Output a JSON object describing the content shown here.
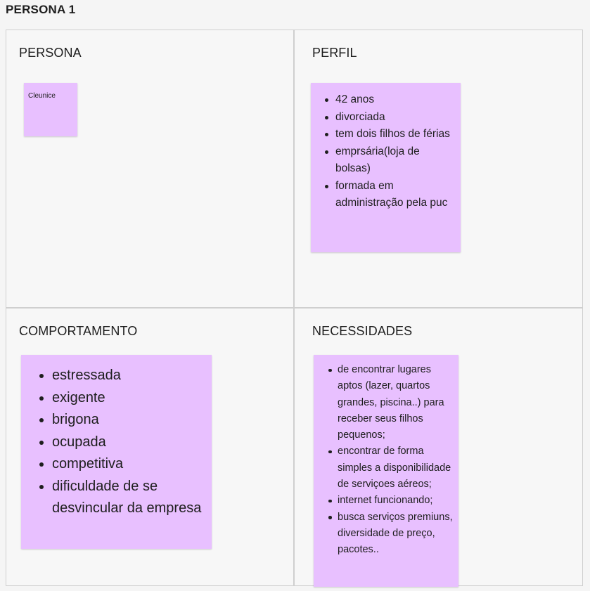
{
  "board": {
    "title": "PERSONA 1"
  },
  "sections": {
    "persona": {
      "title": "PERSONA",
      "note_text": "Cleunice"
    },
    "perfil": {
      "title": "PERFIL",
      "items": [
        "42 anos",
        "divorciada",
        "tem dois filhos de férias",
        "emprsária(loja de bolsas)",
        "formada em administração pela puc"
      ]
    },
    "comportamento": {
      "title": "COMPORTAMENTO",
      "items": [
        "estressada",
        "exigente",
        "brigona",
        "ocupada",
        "competitiva",
        "dificuldade de se desvincular da empresa"
      ]
    },
    "necessidades": {
      "title": "NECESSIDADES",
      "items": [
        "de encontrar lugares aptos (lazer, quartos grandes, piscina..) para receber seus filhos pequenos;",
        "encontrar de forma simples a disponibilidade de serviçoes aéreos;",
        "internet funcionando;",
        "busca serviços premiuns, diversidade de preço, pacotes.."
      ]
    }
  },
  "colors": {
    "sticky": "#e8c0ff",
    "section_border": "#cfcfcf",
    "background": "#f5f5f5"
  }
}
